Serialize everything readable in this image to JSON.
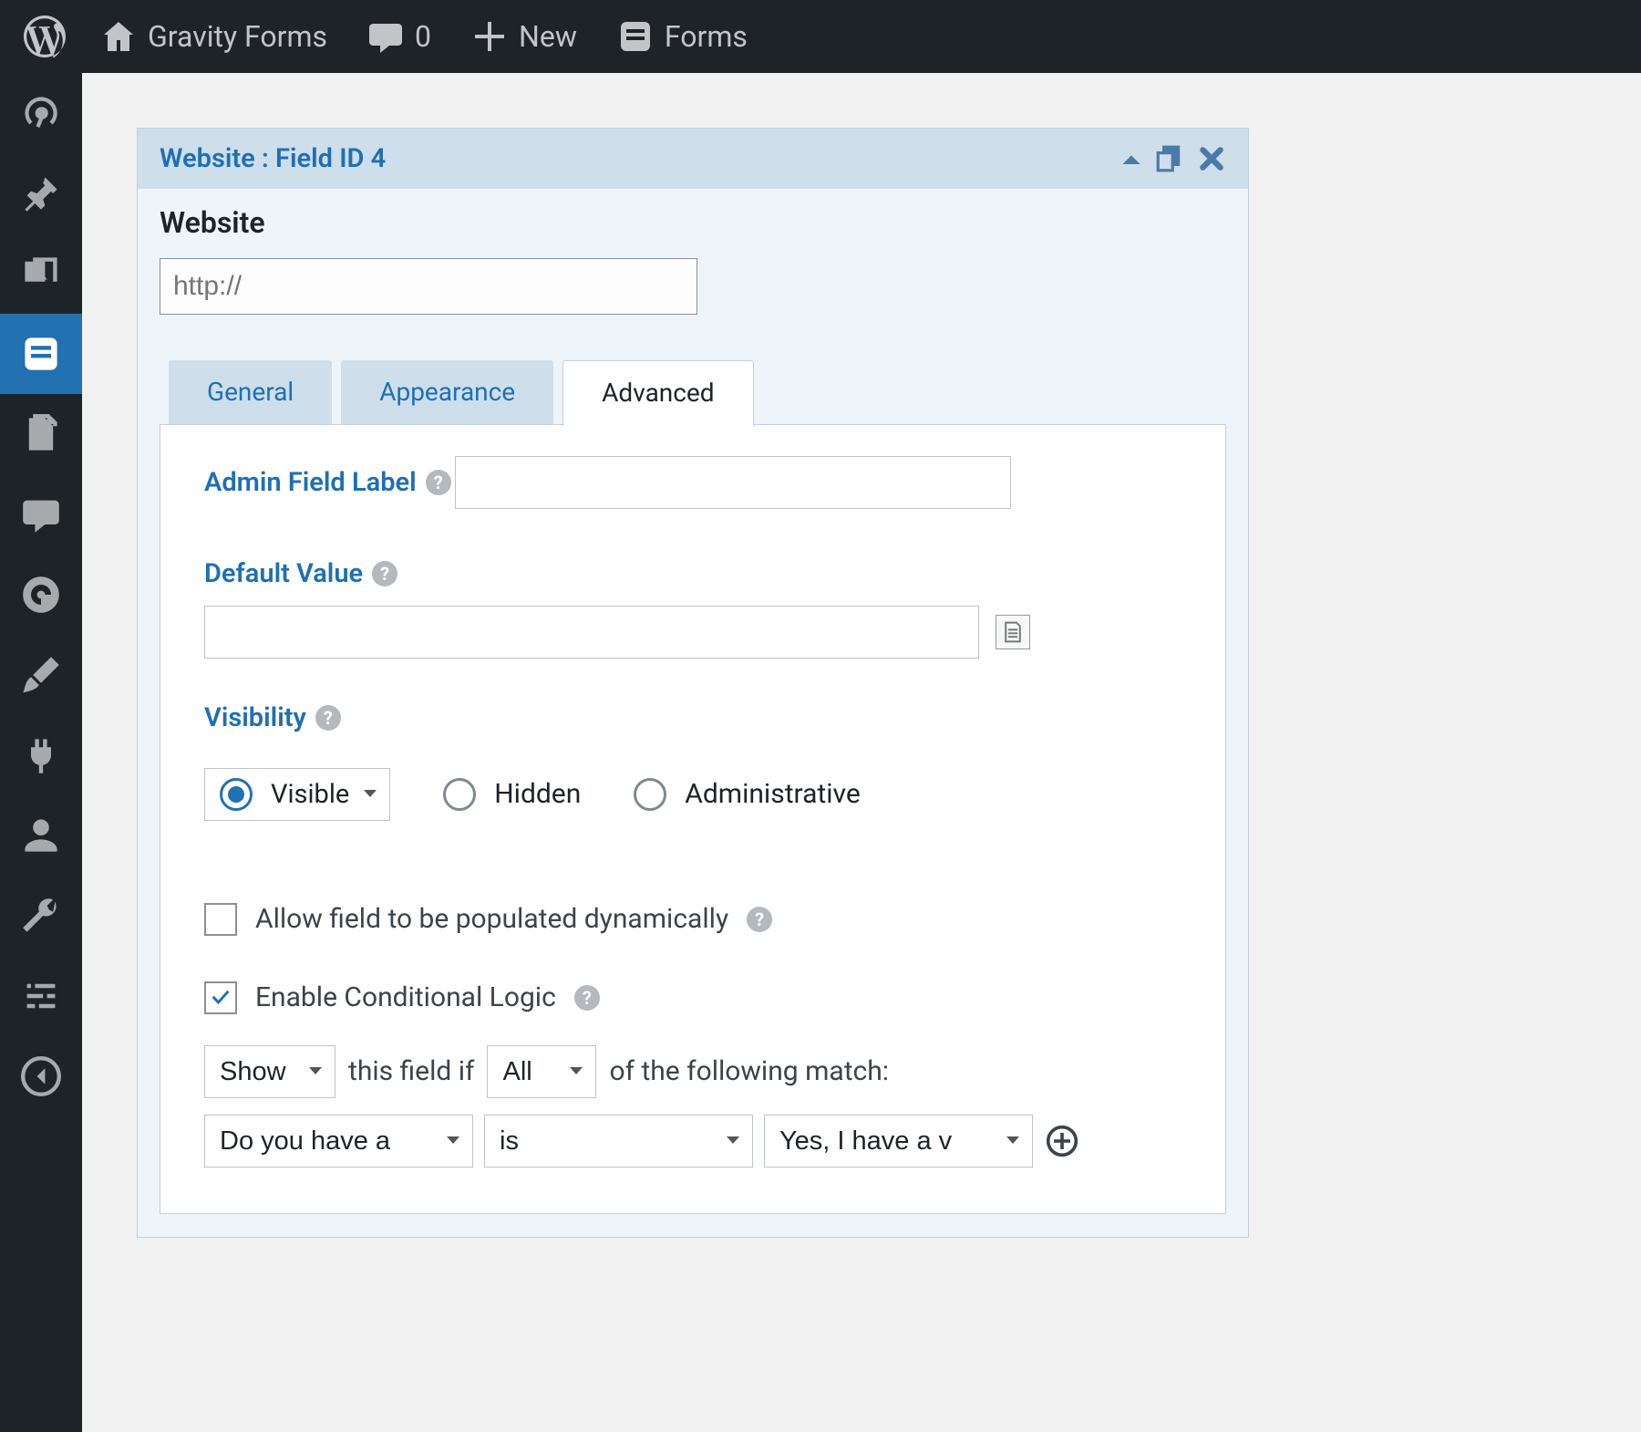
{
  "adminbar": {
    "site_title": "Gravity Forms",
    "comments_count": "0",
    "new_label": "New",
    "forms_label": "Forms"
  },
  "panel": {
    "header_title": "Website : Field ID 4",
    "field_label": "Website",
    "url_placeholder": "http://"
  },
  "tabs": {
    "general": "General",
    "appearance": "Appearance",
    "advanced": "Advanced"
  },
  "adv": {
    "admin_label": "Admin Field Label",
    "default_value": "Default Value",
    "visibility": "Visibility",
    "opt_visible": "Visible",
    "opt_hidden": "Hidden",
    "opt_admin": "Administrative",
    "allow_dynamic": "Allow field to be populated dynamically",
    "enable_cl": "Enable Conditional Logic",
    "cl_mid1": "this field if",
    "cl_mid2": "of the following match:",
    "cl_show": "Show",
    "cl_all": "All",
    "cl_field": "Do you have a",
    "cl_op": "is",
    "cl_val": "Yes, I have a v"
  }
}
